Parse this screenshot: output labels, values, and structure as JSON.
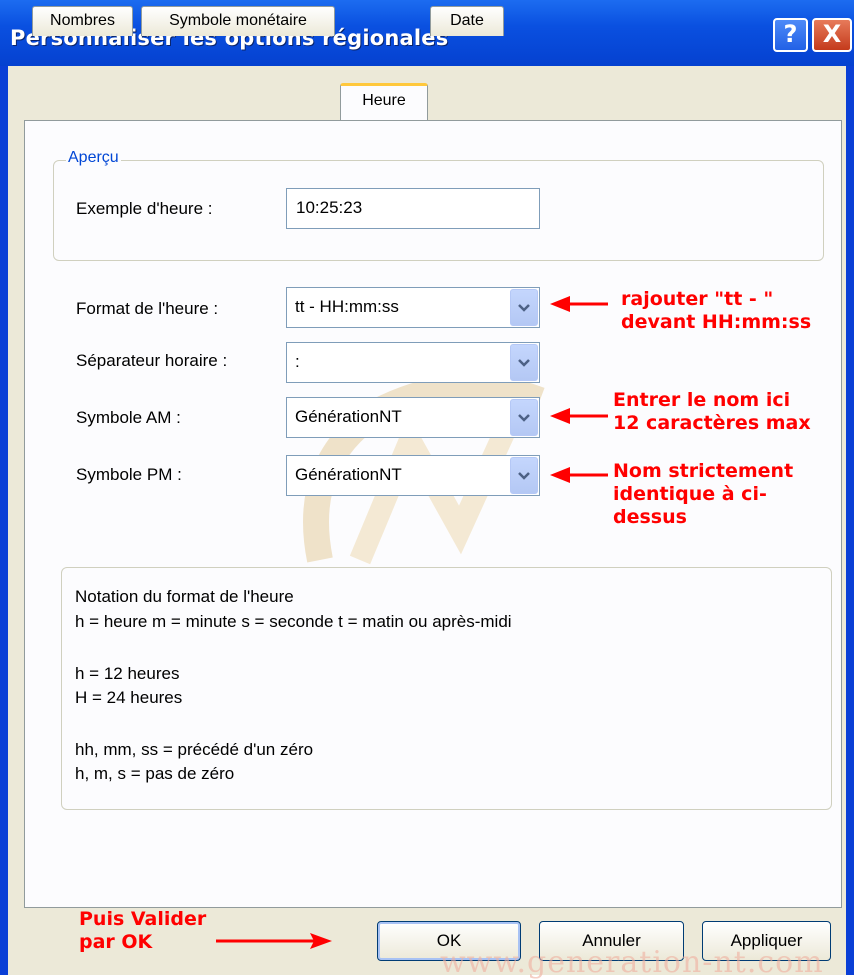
{
  "window": {
    "title": "Personnaliser les options régionales",
    "help_button": "?",
    "close_button": "X"
  },
  "tabs": [
    {
      "label": "Nombres",
      "active": false
    },
    {
      "label": "Symbole monétaire",
      "active": false
    },
    {
      "label": "Heure",
      "active": true
    },
    {
      "label": "Date",
      "active": false
    }
  ],
  "apercu": {
    "legend": "Aperçu",
    "example_label": "Exemple d'heure :",
    "example_value": "10:25:23"
  },
  "fields": {
    "format": {
      "label": "Format de l'heure :",
      "value": "tt - HH:mm:ss"
    },
    "separator": {
      "label": "Séparateur horaire :",
      "value": ":"
    },
    "am": {
      "label": "Symbole AM :",
      "value": "GénérationNT"
    },
    "pm": {
      "label": "Symbole PM :",
      "value": "GénérationNT"
    }
  },
  "annotations": {
    "format_line1": "rajouter \"tt - \"",
    "format_line2": "devant HH:mm:ss",
    "am_line1": "Entrer le nom ici",
    "am_line2": "12 caractères max",
    "pm_line1": "Nom strictement",
    "pm_line2": "identique à ci-",
    "pm_line3": "dessus",
    "ok_line1": "Puis Valider",
    "ok_line2": "par OK"
  },
  "notation": {
    "title": "Notation du format de l'heure",
    "line1": "h = heure    m = minute     s = seconde    t = matin ou après-midi",
    "line2": "h = 12 heures",
    "line3": "H = 24 heures",
    "line4": "hh, mm, ss = précédé d'un zéro",
    "line5": "h, m, s = pas de zéro"
  },
  "buttons": {
    "ok": "OK",
    "cancel": "Annuler",
    "apply": "Appliquer"
  },
  "watermark_text": "www.generation-nt.com",
  "colors": {
    "titlebar": "#0a50e0",
    "annotation": "#ff0000",
    "legend": "#0046d5",
    "active_tab_accent": "#ffc83c"
  }
}
